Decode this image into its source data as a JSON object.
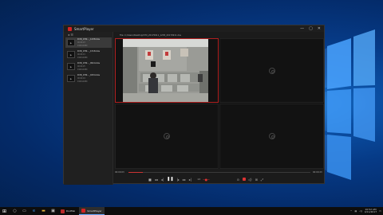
{
  "app": {
    "name": "SmartPlayer",
    "window_controls": [
      "—",
      "▢",
      "✕"
    ]
  },
  "sidebar": {
    "header_icon": "back-arrow-icon",
    "items": [
      {
        "title": "DVR_CH0..._1238.dav",
        "meta": "00:00:23",
        "sub": "1920x1080",
        "active": true
      },
      {
        "title": "DVR_CH0..._1518.dav",
        "meta": "00:00:21",
        "sub": "1920x1080",
        "active": false
      },
      {
        "title": "DVR_CH0..._0914.dav",
        "meta": "00:00:25",
        "sub": "1920x1080",
        "active": false
      },
      {
        "title": "DVR_CH0..._0154.dav",
        "meta": "00:00:19",
        "sub": "1920x1080",
        "active": false
      }
    ]
  },
  "path": "File: C:/Users/Desktop/CH0_20170911_1238_20170911.dav",
  "playback": {
    "current_time": "00:00:03",
    "total_time": "00:00:23",
    "progress": 0.08,
    "speed": "1X"
  },
  "taskbar": {
    "apps": [
      {
        "label": "DvdFab",
        "color": "#b72a2a",
        "active": false
      },
      {
        "label": "SmartPlayer",
        "color": "#d32323",
        "active": true
      }
    ],
    "clock_time": "10:52 AM",
    "clock_date": "4/11/2017"
  },
  "colors": {
    "accent": "#d32323",
    "desktop": "#0b4fa3"
  }
}
